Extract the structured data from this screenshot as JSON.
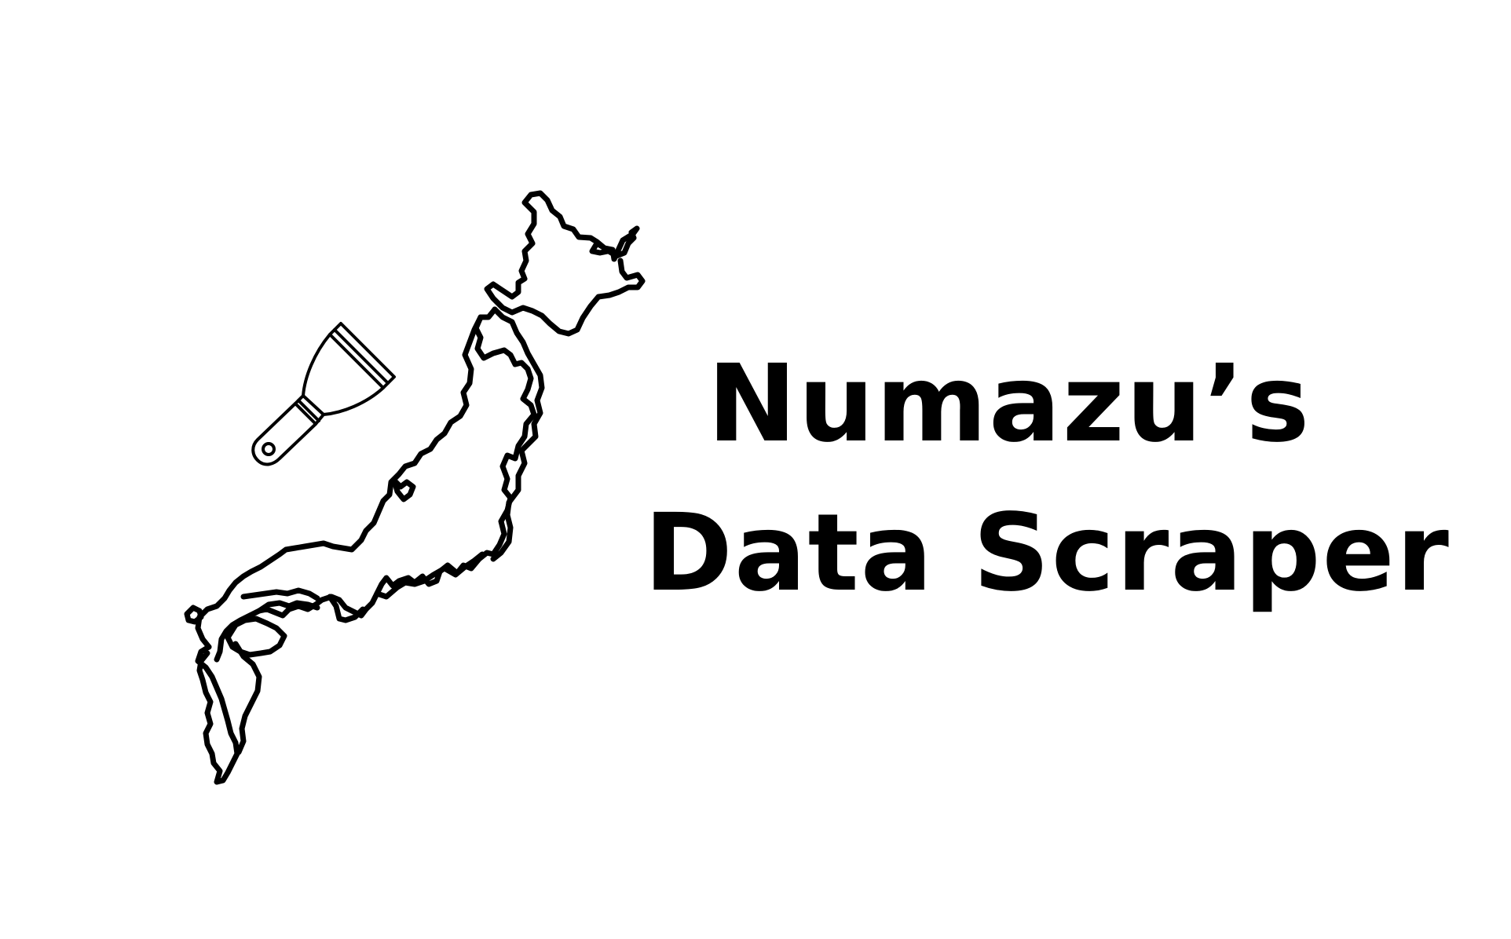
{
  "title": {
    "line1": "Numazu’s",
    "line2": "Data Scraper"
  },
  "icons": {
    "map": "japan-outline-map",
    "tool": "paint-scraper-tool"
  },
  "colors": {
    "background": "#ffffff",
    "ink": "#000000"
  }
}
